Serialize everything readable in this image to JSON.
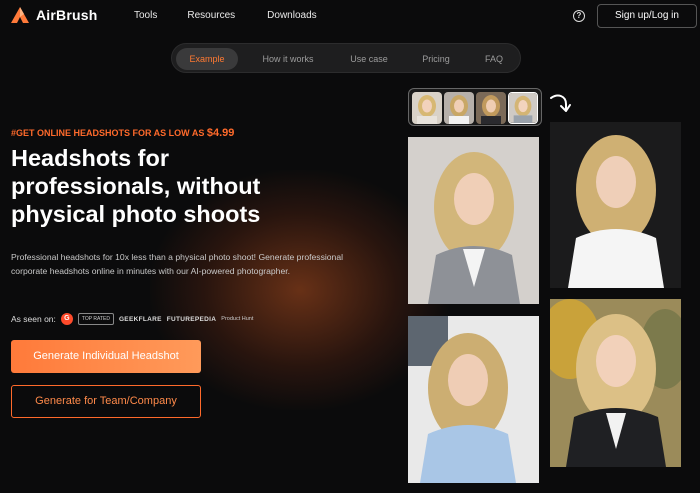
{
  "header": {
    "brand": "AirBrush",
    "nav": [
      "Tools",
      "Resources",
      "Downloads"
    ],
    "help_icon": "?",
    "signin_label": "Sign up/Log in"
  },
  "pill_nav": {
    "items": [
      "Example",
      "How it works",
      "Use case",
      "Pricing",
      "FAQ"
    ],
    "active": "Example"
  },
  "hero": {
    "promo_text": "#GET ONLINE HEADSHOTS FOR AS LOW AS",
    "promo_price": "$4.99",
    "headline_1": "Headshots for",
    "headline_2": "professionals, without",
    "headline_3": "physical photo shoots",
    "description": "Professional headshots for 10x less than a physical photo shoot! Generate professional corporate headshots online in minutes with our AI-powered photographer.",
    "as_seen_on": "As seen on:",
    "badges": {
      "g2": "G",
      "box": "TOP RATED",
      "geekflare": "GEEKFLARE",
      "futurepedia": "FUTUREPEDIA",
      "producthunt": "Product Hunt"
    },
    "primary_button": "Generate Individual Headshot",
    "secondary_button": "Generate for Team/Company"
  },
  "colors": {
    "accent": "#ff6a2b",
    "background": "#0b0b0c"
  }
}
